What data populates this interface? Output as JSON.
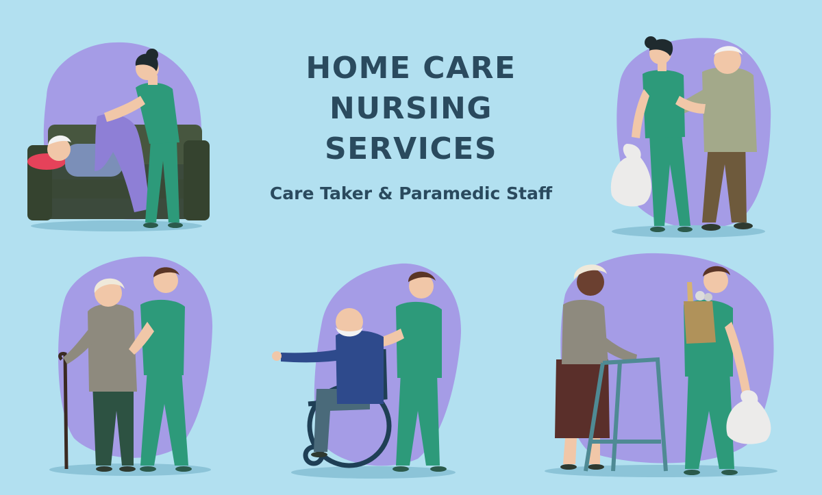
{
  "banner": {
    "title_lines": [
      "HOME CARE",
      "NURSING",
      "SERVICES"
    ],
    "subtitle": "Care Taker & Paramedic Staff"
  },
  "colors": {
    "background": "#b2e0f0",
    "blob": "#a59ce6",
    "scrubs": "#2d9a7a",
    "text": "#2a4a5e"
  },
  "illustrations": [
    {
      "name": "nurse-covering-patient-on-sofa"
    },
    {
      "name": "nurse-walking-elderly-man-with-shopping-bag"
    },
    {
      "name": "nurse-assisting-elderly-woman-with-cane"
    },
    {
      "name": "nurse-pushing-elderly-man-in-wheelchair"
    },
    {
      "name": "nurse-with-groceries-and-elderly-woman-with-walker"
    }
  ]
}
